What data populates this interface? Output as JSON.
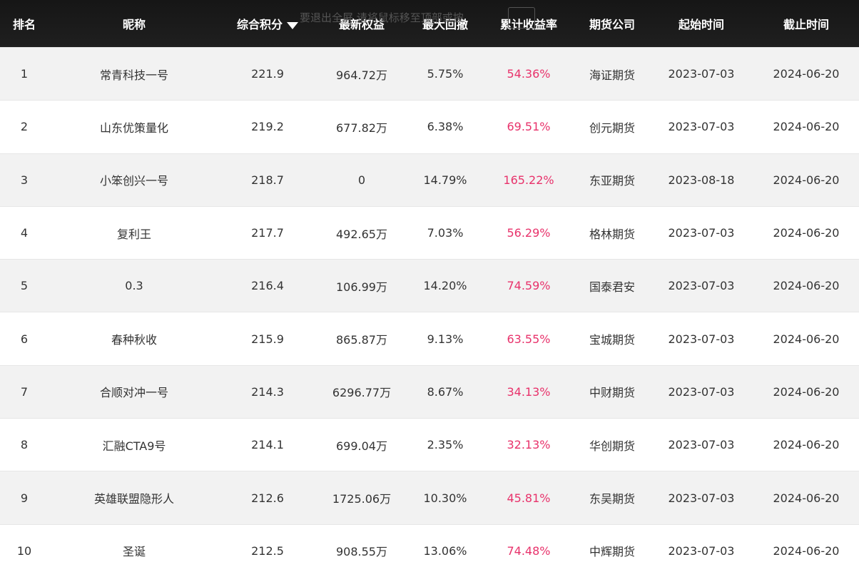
{
  "header": {
    "rank": "排名",
    "name": "昵称",
    "score": "综合积分",
    "equity": "最新权益",
    "drawdown": "最大回撤",
    "return": "累计收益率",
    "company": "期货公司",
    "start": "起始时间",
    "end": "截止时间",
    "overlay_text": "要退出全屏 请将鼠标移至顶部或按"
  },
  "colors": {
    "header_bg": "#1a1a1a",
    "accent_pink": "#e8326b",
    "odd_row": "#f2f2f2",
    "even_row": "#ffffff"
  },
  "rows": [
    {
      "rank": "1",
      "name": "常青科技一号",
      "score": "221.9",
      "equity": "964.72万",
      "drawdown": "5.75%",
      "return": "54.36%",
      "company": "海证期货",
      "start": "2023-07-03",
      "end": "2024-06-20"
    },
    {
      "rank": "2",
      "name": "山东优策量化",
      "score": "219.2",
      "equity": "677.82万",
      "drawdown": "6.38%",
      "return": "69.51%",
      "company": "创元期货",
      "start": "2023-07-03",
      "end": "2024-06-20"
    },
    {
      "rank": "3",
      "name": "小笨创兴一号",
      "score": "218.7",
      "equity": "0",
      "drawdown": "14.79%",
      "return": "165.22%",
      "company": "东亚期货",
      "start": "2023-08-18",
      "end": "2024-06-20"
    },
    {
      "rank": "4",
      "name": "复利王",
      "score": "217.7",
      "equity": "492.65万",
      "drawdown": "7.03%",
      "return": "56.29%",
      "company": "格林期货",
      "start": "2023-07-03",
      "end": "2024-06-20"
    },
    {
      "rank": "5",
      "name": "0.3",
      "score": "216.4",
      "equity": "106.99万",
      "drawdown": "14.20%",
      "return": "74.59%",
      "company": "国泰君安",
      "start": "2023-07-03",
      "end": "2024-06-20"
    },
    {
      "rank": "6",
      "name": "春种秋收",
      "score": "215.9",
      "equity": "865.87万",
      "drawdown": "9.13%",
      "return": "63.55%",
      "company": "宝城期货",
      "start": "2023-07-03",
      "end": "2024-06-20"
    },
    {
      "rank": "7",
      "name": "合顺对冲一号",
      "score": "214.3",
      "equity": "6296.77万",
      "drawdown": "8.67%",
      "return": "34.13%",
      "company": "中财期货",
      "start": "2023-07-03",
      "end": "2024-06-20"
    },
    {
      "rank": "8",
      "name": "汇融CTA9号",
      "score": "214.1",
      "equity": "699.04万",
      "drawdown": "2.35%",
      "return": "32.13%",
      "company": "华创期货",
      "start": "2023-07-03",
      "end": "2024-06-20"
    },
    {
      "rank": "9",
      "name": "英雄联盟隐形人",
      "score": "212.6",
      "equity": "1725.06万",
      "drawdown": "10.30%",
      "return": "45.81%",
      "company": "东吴期货",
      "start": "2023-07-03",
      "end": "2024-06-20"
    },
    {
      "rank": "10",
      "name": "圣诞",
      "score": "212.5",
      "equity": "908.55万",
      "drawdown": "13.06%",
      "return": "74.48%",
      "company": "中辉期货",
      "start": "2023-07-03",
      "end": "2024-06-20"
    }
  ]
}
